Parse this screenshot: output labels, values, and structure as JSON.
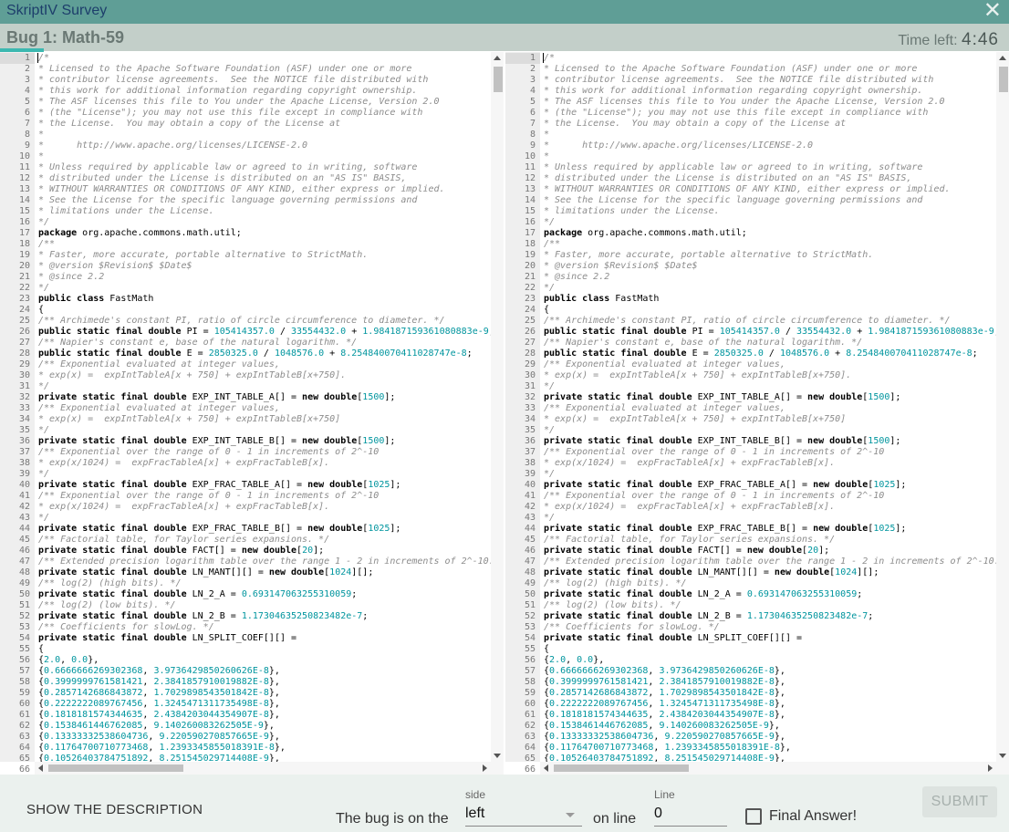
{
  "app": {
    "title": "SkriptIV Survey",
    "close_icon": "close-icon"
  },
  "header": {
    "bug_title": "Bug 1: Math-59",
    "time_left_label": "Time left:",
    "time_minutes": "4",
    "time_sep": ":",
    "time_seconds": "46"
  },
  "colors": {
    "titlebar": "#5f9e96",
    "header": "#c3cfc9",
    "accent": "#3cb8b0",
    "number": "#00959e",
    "comment": "#8c8c8c",
    "footer": "#ebf1ee"
  },
  "editor": {
    "active_line": 1,
    "lines": [
      "/*",
      "* Licensed to the Apache Software Foundation (ASF) under one or more",
      "* contributor license agreements.  See the NOTICE file distributed with",
      "* this work for additional information regarding copyright ownership.",
      "* The ASF licenses this file to You under the Apache License, Version 2.0",
      "* (the \"License\"); you may not use this file except in compliance with",
      "* the License.  You may obtain a copy of the License at",
      "*",
      "*      http://www.apache.org/licenses/LICENSE-2.0",
      "*",
      "* Unless required by applicable law or agreed to in writing, software",
      "* distributed under the License is distributed on an \"AS IS\" BASIS,",
      "* WITHOUT WARRANTIES OR CONDITIONS OF ANY KIND, either express or implied.",
      "* See the License for the specific language governing permissions and",
      "* limitations under the License.",
      "*/",
      "package org.apache.commons.math.util;",
      "/**",
      "* Faster, more accurate, portable alternative to StrictMath.",
      "* @version $Revision$ $Date$",
      "* @since 2.2",
      "*/",
      "public class FastMath",
      "{",
      "/** Archimede's constant PI, ratio of circle circumference to diameter. */",
      "public static final double PI = 105414357.0 / 33554432.0 + 1.984187159361080883e-9;",
      "/** Napier's constant e, base of the natural logarithm. */",
      "public static final double E = 2850325.0 / 1048576.0 + 8.254840070411028747e-8;",
      "/** Exponential evaluated at integer values,",
      "* exp(x) =  expIntTableA[x + 750] + expIntTableB[x+750].",
      "*/",
      "private static final double EXP_INT_TABLE_A[] = new double[1500];",
      "/** Exponential evaluated at integer values,",
      "* exp(x) =  expIntTableA[x + 750] + expIntTableB[x+750]",
      "*/",
      "private static final double EXP_INT_TABLE_B[] = new double[1500];",
      "/** Exponential over the range of 0 - 1 in increments of 2^-10",
      "* exp(x/1024) =  expFracTableA[x] + expFracTableB[x].",
      "*/",
      "private static final double EXP_FRAC_TABLE_A[] = new double[1025];",
      "/** Exponential over the range of 0 - 1 in increments of 2^-10",
      "* exp(x/1024) =  expFracTableA[x] + expFracTableB[x].",
      "*/",
      "private static final double EXP_FRAC_TABLE_B[] = new double[1025];",
      "/** Factorial table, for Taylor series expansions. */",
      "private static final double FACT[] = new double[20];",
      "/** Extended precision logarithm table over the range 1 - 2 in increments of 2^-10.",
      "private static final double LN_MANT[][] = new double[1024][];",
      "/** log(2) (high bits). */",
      "private static final double LN_2_A = 0.693147063255310059;",
      "/** log(2) (low bits). */",
      "private static final double LN_2_B = 1.17304635250823482e-7;",
      "/** Coefficients for slowLog. */",
      "private static final double LN_SPLIT_COEF[][] =",
      "{",
      "{2.0, 0.0},",
      "{0.6666666269302368, 3.9736429850260626E-8},",
      "{0.3999999761581421, 2.3841857910019882E-8},",
      "{0.2857142686843872, 1.7029898543501842E-8},",
      "{0.2222222089767456, 1.3245471311735498E-8},",
      "{0.1818181574344635, 2.4384203044354907E-8},",
      "{0.1538461446762085, 9.140260083262505E-9},",
      "{0.13333332538604736, 9.220590270857665E-9},",
      "{0.11764700710773468, 1.2393345855018391E-8},",
      "{0.10526403784751892, 8.251545029714408E-9},",
      ""
    ]
  },
  "footer": {
    "show_description": "SHOW THE DESCRIPTION",
    "bug_on_the": "The bug is on the",
    "side_label": "side",
    "side_value": "left",
    "on_line": "on line",
    "line_label": "Line",
    "line_value": "0",
    "final_answer": "Final Answer!",
    "submit": "SUBMIT"
  }
}
